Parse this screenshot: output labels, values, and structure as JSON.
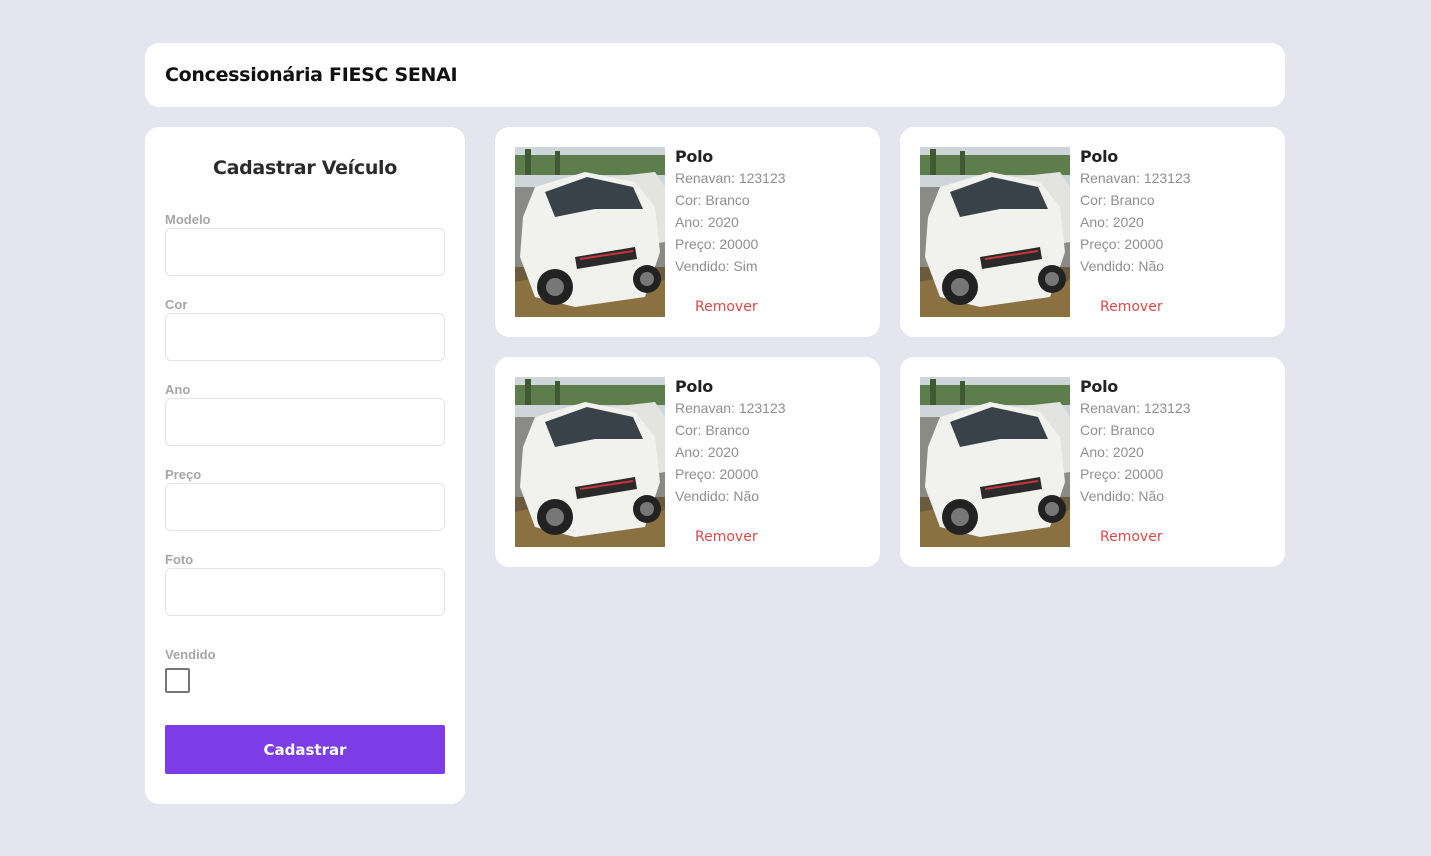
{
  "header": {
    "title": "Concessionária FIESC SENAI"
  },
  "form": {
    "title": "Cadastrar Veículo",
    "fields": [
      {
        "label": "Modelo",
        "value": ""
      },
      {
        "label": "Cor",
        "value": ""
      },
      {
        "label": "Ano",
        "value": ""
      },
      {
        "label": "Preço",
        "value": ""
      },
      {
        "label": "Foto",
        "value": ""
      }
    ],
    "vendido_label": "Vendido",
    "vendido_checked": false,
    "submit_label": "Cadastrar",
    "submit_color": "#7c3de6"
  },
  "cars": [
    {
      "model": "Polo",
      "renavan": "Renavan: 123123",
      "cor": "Cor: Branco",
      "ano": "Ano: 2020",
      "preco": "Preço: 20000",
      "vendido": "Vendido: Sim",
      "remove_label": "Remover"
    },
    {
      "model": "Polo",
      "renavan": "Renavan: 123123",
      "cor": "Cor: Branco",
      "ano": "Ano: 2020",
      "preco": "Preço: 20000",
      "vendido": "Vendido: Não",
      "remove_label": "Remover"
    },
    {
      "model": "Polo",
      "renavan": "Renavan: 123123",
      "cor": "Cor: Branco",
      "ano": "Ano: 2020",
      "preco": "Preço: 20000",
      "vendido": "Vendido: Não",
      "remove_label": "Remover"
    },
    {
      "model": "Polo",
      "renavan": "Renavan: 123123",
      "cor": "Cor: Branco",
      "ano": "Ano: 2020",
      "preco": "Preço: 20000",
      "vendido": "Vendido: Não",
      "remove_label": "Remover"
    }
  ],
  "colors": {
    "background": "#e5e5ef",
    "remove": "#e04848",
    "accent": "#7c3de6"
  }
}
